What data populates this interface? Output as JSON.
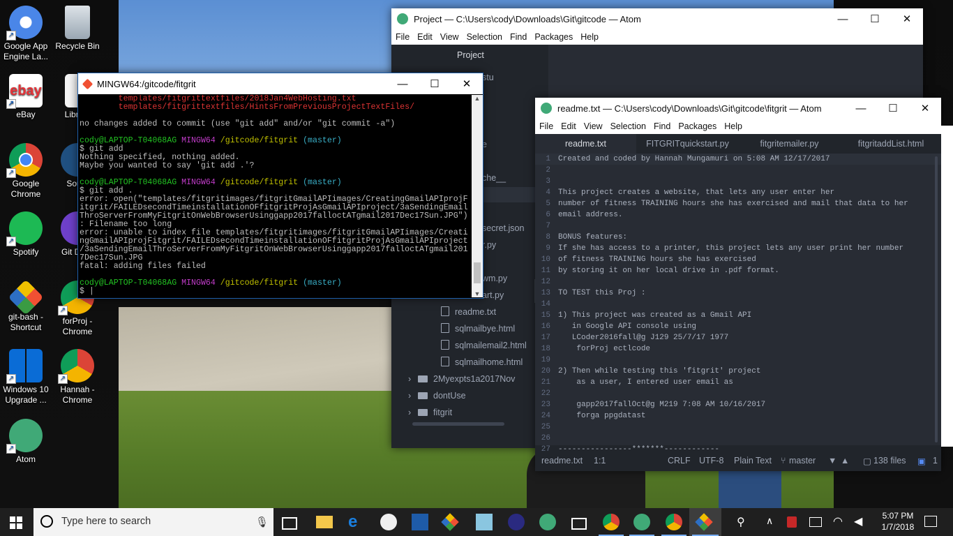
{
  "desktop": {
    "icons": [
      {
        "label": "Google App Engine La...",
        "icon": "app-engine-icon",
        "color": "#4a86e8"
      },
      {
        "label": "Recycle Bin",
        "icon": "recycle-bin-icon",
        "color": "#9aa7b3"
      },
      {
        "label": "eBay",
        "icon": "ebay-icon",
        "color": "#ffffff"
      },
      {
        "label": "Libre 5",
        "icon": "libreoffice-icon",
        "color": "#ffffff"
      },
      {
        "label": "Google Chrome",
        "icon": "chrome-icon",
        "color": "#e8453c"
      },
      {
        "label": "Sourc",
        "icon": "sourcetree-icon",
        "color": "#205081"
      },
      {
        "label": "Spotify",
        "icon": "spotify-icon",
        "color": "#1db954"
      },
      {
        "label": "Git Desk",
        "icon": "github-desktop-icon",
        "color": "#6e40c9"
      },
      {
        "label": "git-bash - Shortcut",
        "icon": "git-bash-icon",
        "color": "#f05033"
      },
      {
        "label": "forProj - Chrome",
        "icon": "chrome-profile-icon",
        "color": "#e8453c"
      },
      {
        "label": "Windows 10 Upgrade ...",
        "icon": "windows-upgrade-icon",
        "color": "#0a6cd6"
      },
      {
        "label": "Hannah - Chrome",
        "icon": "chrome-profile-icon",
        "color": "#e8453c"
      },
      {
        "label": "Atom",
        "icon": "atom-icon",
        "color": "#40a977"
      }
    ]
  },
  "gitbash": {
    "title": "MINGW64:/gitcode/fitgrit",
    "prompt_user": "cody@LAPTOP-T04068AG",
    "prompt_env": "MINGW64",
    "prompt_path": "/gitcode/fitgrit",
    "prompt_branch": "(master)",
    "lines": {
      "r1": "        templates/fitgrittextfiles/2018Jan4WebHosting.txt",
      "r2": "        templates/fitgrittextfiles/HintsFromPreviousProjectTextFiles/",
      "nochanges": "no changes added to commit (use \"git add\" and/or \"git commit -a\")",
      "cmd1": "$ git add",
      "out1": "Nothing specified, nothing added.",
      "out2": "Maybe you wanted to say 'git add .'?",
      "cmd2": "$ git add .",
      "e1": "error: open(\"templates/fitgritimages/fitgritGmailAPIimages/CreatingGmailAPIprojF",
      "e2": "itgrit/FAILEDsecondTimeinstallationOFfitgritProjAsGmailAPIproject/3aSendingEmail",
      "e3": "ThroServerFromMyFitgritOnWebBrowserUsinggapp2017falloctATgmail2017Dec17Sun.JPG\")",
      "e4": ": Filename too long",
      "e5": "error: unable to index file templates/fitgritimages/fitgritGmailAPIimages/Creati",
      "e6": "ngGmailAPIprojFitgrit/FAILEDsecondTimeinstallationOFfitgritProjAsGmailAPIproject",
      "e7": "/3aSendingEmailThroServerFromMyFitgritOnWebBrowserUsinggapp2017falloctATgmail201",
      "e8": "7Dec17Sun.JPG",
      "e9": "fatal: adding files failed",
      "cmd3": "$ |"
    }
  },
  "atom1": {
    "title": "Project — C:\\Users\\cody\\Downloads\\Git\\gitcode — Atom",
    "menu": [
      "File",
      "Edit",
      "View",
      "Selection",
      "Find",
      "Packages",
      "Help"
    ],
    "tree_header": "Project",
    "tree_partial": [
      "stu",
      "e",
      "che__",
      "secret.json",
      "r.py",
      "wm.py",
      "art.py"
    ],
    "files": [
      "readme.txt",
      "sqlmailbye.html",
      "sqlmailemail2.html",
      "sqlmailhome.html"
    ],
    "folders": [
      "2Myexpts1a2017Nov",
      "dontUse",
      "fitgrit"
    ]
  },
  "atom2": {
    "title": "readme.txt — C:\\Users\\cody\\Downloads\\Git\\gitcode\\fitgrit — Atom",
    "menu": [
      "File",
      "Edit",
      "View",
      "Selection",
      "Find",
      "Packages",
      "Help"
    ],
    "tabs": [
      "readme.txt",
      "FITGRITquickstart.py",
      "fitgritemailer.py",
      "fitgritaddList.html"
    ],
    "lines": [
      {
        "n": "1",
        "t": "Created and coded by Hannah Mungamuri on 5:08 AM 12/17/2017"
      },
      {
        "n": "2",
        "t": ""
      },
      {
        "n": "3",
        "t": ""
      },
      {
        "n": "4",
        "t": "This project creates a website, that lets any user enter her"
      },
      {
        "n": "5",
        "t": "number of fitness TRAINING hours she has exercised and mail that data to her"
      },
      {
        "n": "6",
        "t": "email address."
      },
      {
        "n": "7",
        "t": ""
      },
      {
        "n": "8",
        "t": "BONUS features:"
      },
      {
        "n": "9",
        "t": "If she has access to a printer, this project lets any user print her number"
      },
      {
        "n": "10",
        "t": "of fitness TRAINING hours she has exercised"
      },
      {
        "n": "11",
        "t": "by storing it on her local drive in .pdf format."
      },
      {
        "n": "12",
        "t": ""
      },
      {
        "n": "13",
        "t": "TO TEST this Proj :"
      },
      {
        "n": "14",
        "t": ""
      },
      {
        "n": "15",
        "t": "1) This project was created as a Gmail API"
      },
      {
        "n": "16",
        "t": "   in Google API console using"
      },
      {
        "n": "17",
        "t": "   LCoder2016fall@g J129 25/7/17 1977"
      },
      {
        "n": "18",
        "t": "    forProj ectlcode"
      },
      {
        "n": "19",
        "t": ""
      },
      {
        "n": "20",
        "t": "2) Then while testing this 'fitgrit' project"
      },
      {
        "n": "21",
        "t": "    as a user, I entered user email as"
      },
      {
        "n": "22",
        "t": ""
      },
      {
        "n": "23",
        "t": "    gapp2017fallOct@g M219 7:08 AM 10/16/2017"
      },
      {
        "n": "24",
        "t": "    forga ppgdatast"
      },
      {
        "n": "25",
        "t": ""
      },
      {
        "n": "26",
        "t": ""
      },
      {
        "n": "27",
        "t": "----------------*******------------"
      }
    ],
    "status": {
      "file": "readme.txt",
      "cursor": "1:1",
      "eol": "CRLF",
      "encoding": "UTF-8",
      "grammar": "Plain Text",
      "branch": "master",
      "files": "138 files",
      "extra": "1"
    }
  },
  "taskbar": {
    "search_placeholder": "Type here to search",
    "time": "5:07 PM",
    "date": "1/7/2018",
    "apps": [
      "task-view-icon",
      "file-explorer-icon",
      "edge-icon",
      "paint-icon",
      "powershell-icon",
      "git-gui-icon",
      "notepad-icon",
      "media-icon",
      "atom-icon",
      "mail-icon",
      "chrome-icon",
      "atom-icon",
      "chrome-icon",
      "git-bash-icon"
    ]
  }
}
